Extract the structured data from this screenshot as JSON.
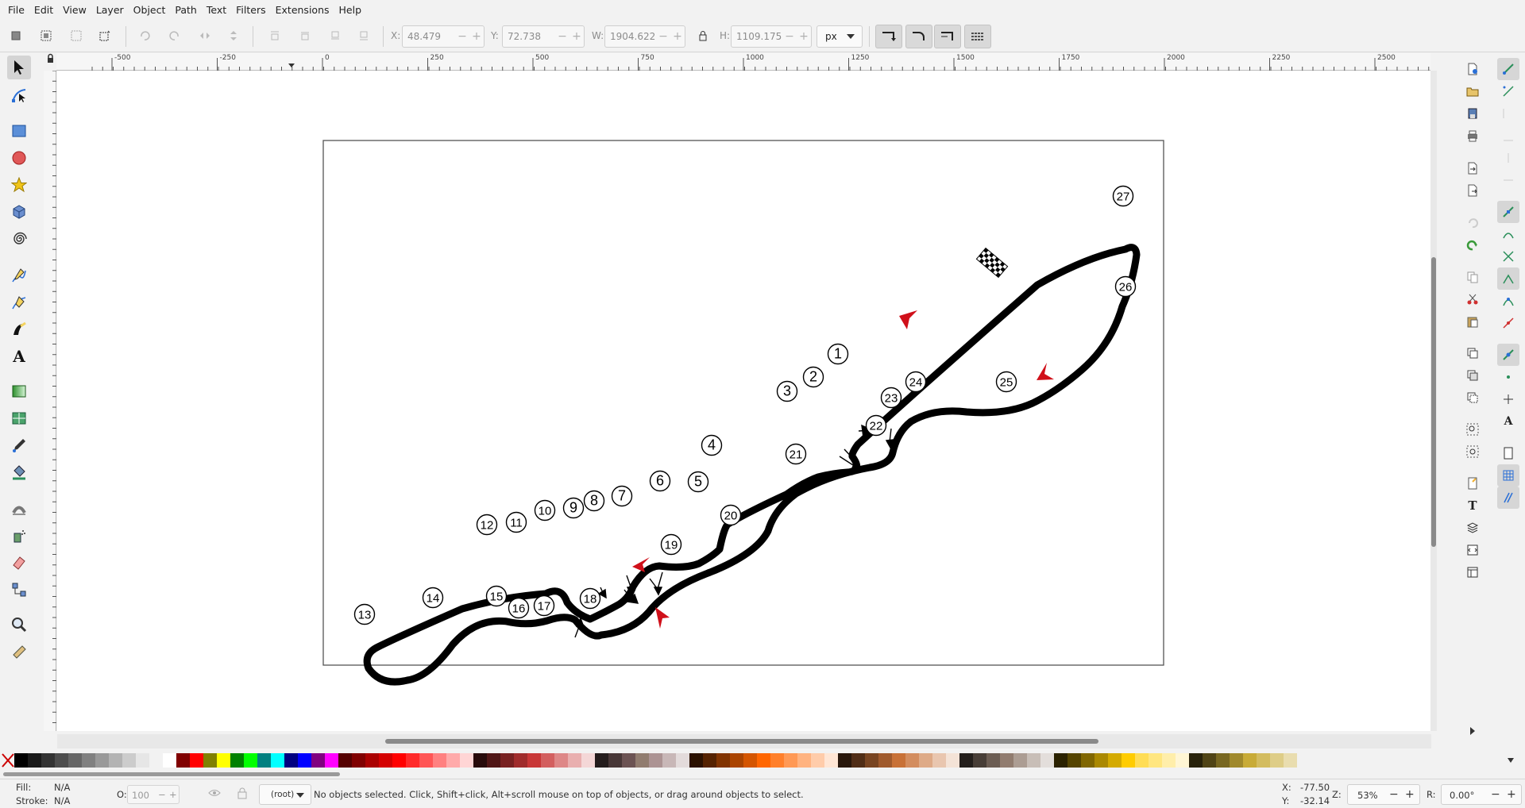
{
  "menu": [
    "File",
    "Edit",
    "View",
    "Layer",
    "Object",
    "Path",
    "Text",
    "Filters",
    "Extensions",
    "Help"
  ],
  "toolbar": {
    "x_label": "X:",
    "x_value": "48.479",
    "y_label": "Y:",
    "y_value": "72.738",
    "w_label": "W:",
    "w_value": "1904.622",
    "h_label": "H:",
    "h_value": "1109.175",
    "unit": "px"
  },
  "ruler_labels": [
    "-500",
    "-250",
    "0",
    "250",
    "500",
    "750",
    "1000",
    "1250",
    "1500",
    "1750",
    "2000",
    "2250",
    "2500"
  ],
  "drawing": {
    "turn_numbers": [
      "1",
      "2",
      "3",
      "4",
      "5",
      "6",
      "7",
      "8",
      "9",
      "10",
      "11",
      "12",
      "13",
      "14",
      "15",
      "16",
      "17",
      "18",
      "19",
      "20",
      "21",
      "22",
      "23",
      "24",
      "25",
      "26",
      "27"
    ],
    "track_color": "#000000",
    "direction_arrow_color": "#d0101a"
  },
  "palette_colors": [
    "#000000",
    "#1a1a1a",
    "#333333",
    "#4d4d4d",
    "#666666",
    "#808080",
    "#999999",
    "#b3b3b3",
    "#cccccc",
    "#e6e6e6",
    "#f2f2f2",
    "#ffffff",
    "#800000",
    "#ff0000",
    "#808000",
    "#ffff00",
    "#008000",
    "#00ff00",
    "#008080",
    "#00ffff",
    "#000080",
    "#0000ff",
    "#800080",
    "#ff00ff",
    "#550000",
    "#800000",
    "#aa0000",
    "#d40000",
    "#ff0000",
    "#ff2a2a",
    "#ff5555",
    "#ff8080",
    "#ffaaaa",
    "#ffd5d5",
    "#280b0b",
    "#501616",
    "#782121",
    "#a02c2c",
    "#c83737",
    "#d35f5f",
    "#de8787",
    "#e9afaf",
    "#f4d7d7",
    "#241c1c",
    "#483737",
    "#6c5353",
    "#917c6f",
    "#ac9393",
    "#c8b7b7",
    "#e3dbdb",
    "#2b1100",
    "#552200",
    "#803300",
    "#aa4400",
    "#d45500",
    "#ff6600",
    "#ff7f2a",
    "#ff9955",
    "#ffb380",
    "#ffccaa",
    "#ffe6d5",
    "#28170b",
    "#502d16",
    "#784421",
    "#a05a2c",
    "#c87137",
    "#d38d5f",
    "#deaa87",
    "#e9c6af",
    "#f4e3d7",
    "#241f1c",
    "#483e37",
    "#6c5d53",
    "#917c6f",
    "#ac9d93",
    "#c8beb7",
    "#e3dedb",
    "#2b2200",
    "#554400",
    "#806600",
    "#aa8800",
    "#d4aa00",
    "#ffcc00",
    "#ffdd55",
    "#ffe680",
    "#ffeeaa",
    "#fff6d5",
    "#28220b",
    "#504416",
    "#786721",
    "#a0892c",
    "#c8ab37",
    "#d3bc5f",
    "#decd87",
    "#e9ddaf"
  ],
  "status": {
    "fill_label": "Fill:",
    "fill_value": "N/A",
    "stroke_label": "Stroke:",
    "stroke_value": "N/A",
    "opacity_label": "O:",
    "opacity_value": "100",
    "layer": "(root)",
    "message": "No objects selected. Click, Shift+click, Alt+scroll mouse on top of objects, or drag around objects to select.",
    "x_label": "X:",
    "x_value": "-77.50",
    "y_label": "Y:",
    "y_value": "-32.14",
    "zoom_label": "Z:",
    "zoom_value": "53%",
    "rotation_label": "R:",
    "rotation_value": "0.00°"
  }
}
